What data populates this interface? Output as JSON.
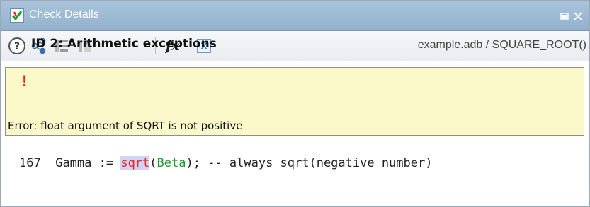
{
  "window": {
    "title": "Check Details",
    "icons": {
      "app": "check-icon",
      "restore": "restore-icon",
      "close": "close-icon"
    }
  },
  "toolbar": {
    "buttons": [
      {
        "name": "help-icon"
      },
      {
        "name": "graph-icon"
      },
      {
        "name": "grid-icon"
      },
      {
        "name": "panel-icon"
      }
    ],
    "fx_label": "fx",
    "location": "example.adb / SQUARE_ROOT()"
  },
  "check": {
    "marker": "!",
    "title": "ID 2: Arithmetic exceptions",
    "message": "Error: float argument of SQRT is not positive"
  },
  "code": {
    "line_number": "167",
    "before": "Gamma := ",
    "function": "sqrt",
    "arg_open": "(",
    "argument": "Beta",
    "after": "); -- always sqrt(negative number)"
  },
  "colors": {
    "title_bar": "#a9c4dc",
    "banner_bg": "#fbf8c9",
    "error_red": "#e8231b",
    "arg_green": "#1a9a2a",
    "highlight": "#d2d2f5"
  }
}
